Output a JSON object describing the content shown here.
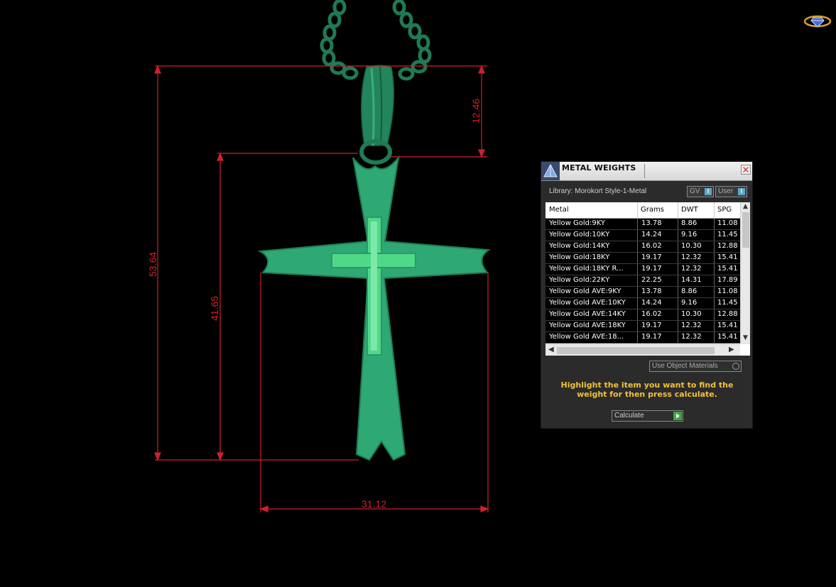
{
  "dimensions": {
    "bail_height": "12.46",
    "total_height": "53.64",
    "cross_height": "41.65",
    "width": "31.12"
  },
  "colors": {
    "dimension_line": "#d0202a",
    "model": "#2ea874",
    "cross_inlay": "#4fd88a",
    "instruction_text": "#f0c23a"
  },
  "logo": {
    "icon": "gem-logo-icon"
  },
  "panel": {
    "title": "METAL WEIGHTS",
    "app_icon": "pyramid-app-icon",
    "close_icon": "close-icon",
    "library_label": "Library: Morokort Style-1-Metal",
    "gv_toggle": "GV",
    "user_toggle": "User",
    "toggle_glyph": "I",
    "columns": [
      "Metal",
      "Grams",
      "DWT",
      "SPG"
    ],
    "rows": [
      [
        "Yellow Gold:9KY",
        "13.78",
        "8.86",
        "11.08"
      ],
      [
        "Yellow Gold:10KY",
        "14.24",
        "9.16",
        "11.45"
      ],
      [
        "Yellow Gold:14KY",
        "16.02",
        "10.30",
        "12.88"
      ],
      [
        "Yellow Gold:18KY",
        "19.17",
        "12.32",
        "15.41"
      ],
      [
        "Yellow Gold:18KY R...",
        "19.17",
        "12.32",
        "15.41"
      ],
      [
        "Yellow Gold:22KY",
        "22.25",
        "14.31",
        "17.89"
      ],
      [
        "Yellow Gold AVE:9KY",
        "13.78",
        "8.86",
        "11.08"
      ],
      [
        "Yellow Gold AVE:10KY",
        "14.24",
        "9.16",
        "11.45"
      ],
      [
        "Yellow Gold AVE:14KY",
        "16.02",
        "10.30",
        "12.88"
      ],
      [
        "Yellow Gold AVE:18KY",
        "19.17",
        "12.32",
        "15.41"
      ],
      [
        "Yellow Gold AVE:18...",
        "19.17",
        "12.32",
        "15.41"
      ]
    ],
    "use_object_materials": "Use Object Materials",
    "instruction": "Highlight the item you want to find the weight for then press calculate.",
    "calculate_label": "Calculate"
  }
}
